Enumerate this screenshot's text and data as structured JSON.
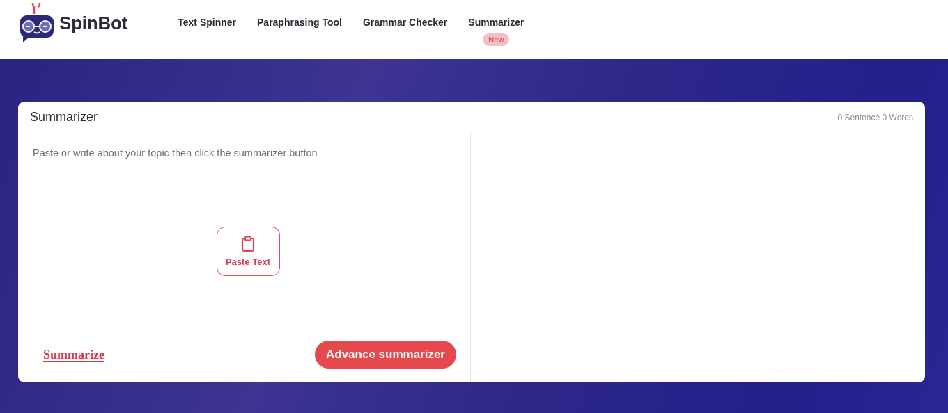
{
  "logo": {
    "text": "SpinBot"
  },
  "nav": [
    {
      "label": "Text Spinner"
    },
    {
      "label": "Paraphrasing Tool"
    },
    {
      "label": "Grammar Checker"
    },
    {
      "label": "Summarizer",
      "badge": "New"
    }
  ],
  "card": {
    "title": "Summarizer",
    "stats": "0 Sentence 0 Words",
    "input": {
      "placeholder": "Paste or write about your topic then click the summarizer button"
    },
    "paste_button": "Paste Text",
    "summarize_link": "Summarize",
    "advance_button": "Advance summarizer"
  }
}
